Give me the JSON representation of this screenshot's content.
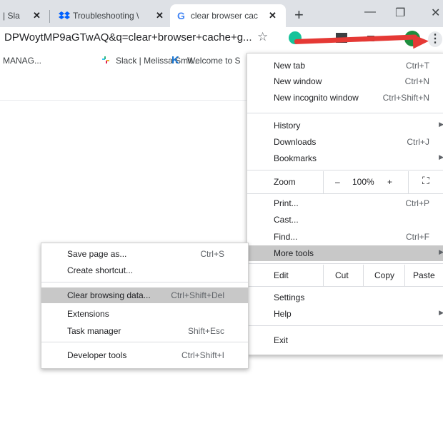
{
  "tabs": [
    {
      "label": "| Sla"
    },
    {
      "label": "Troubleshooting \\"
    },
    {
      "label": "clear browser cac"
    }
  ],
  "tab_close": "✕",
  "newtab": "+",
  "window": {
    "minimize": "—",
    "restore": "❐",
    "close": "✕"
  },
  "omnibox": {
    "url": "DPWoytMP9aGTwAQ&q=clear+browser+cache+g..."
  },
  "bookmarks": [
    {
      "label": "MANAG..."
    },
    {
      "label": "Slack | Melissa Smit..."
    },
    {
      "label": "Welcome to S"
    }
  ],
  "menu": {
    "new_tab": {
      "label": "New tab",
      "shortcut": "Ctrl+T"
    },
    "new_window": {
      "label": "New window",
      "shortcut": "Ctrl+N"
    },
    "new_incognito": {
      "label": "New incognito window",
      "shortcut": "Ctrl+Shift+N"
    },
    "history": {
      "label": "History"
    },
    "downloads": {
      "label": "Downloads",
      "shortcut": "Ctrl+J"
    },
    "bookmarks": {
      "label": "Bookmarks"
    },
    "zoom": {
      "label": "Zoom",
      "minus": "–",
      "value": "100%",
      "plus": "+"
    },
    "print": {
      "label": "Print...",
      "shortcut": "Ctrl+P"
    },
    "cast": {
      "label": "Cast..."
    },
    "find": {
      "label": "Find...",
      "shortcut": "Ctrl+F"
    },
    "more_tools": {
      "label": "More tools"
    },
    "edit": {
      "label": "Edit",
      "cut": "Cut",
      "copy": "Copy",
      "paste": "Paste"
    },
    "settings": {
      "label": "Settings"
    },
    "help": {
      "label": "Help"
    },
    "exit": {
      "label": "Exit"
    }
  },
  "submenu": {
    "save_page": {
      "label": "Save page as...",
      "shortcut": "Ctrl+S"
    },
    "create_shortcut": {
      "label": "Create shortcut..."
    },
    "clear_browsing": {
      "label": "Clear browsing data...",
      "shortcut": "Ctrl+Shift+Del"
    },
    "extensions": {
      "label": "Extensions"
    },
    "task_manager": {
      "label": "Task manager",
      "shortcut": "Shift+Esc"
    },
    "developer_tools": {
      "label": "Developer tools",
      "shortcut": "Ctrl+Shift+I"
    }
  },
  "icons": {
    "star": "☆",
    "kebab": "⋮",
    "submenu_arrow": "▶",
    "fullscreen": "⛶",
    "slack": "slack-icon",
    "k": "K",
    "google_g": "G",
    "troubleshoot": "dropbox-icon"
  },
  "colors": {
    "annotation_arrow": "#e53935",
    "highlight": "#c8c8c8",
    "tabstrip": "#dee1e6"
  }
}
